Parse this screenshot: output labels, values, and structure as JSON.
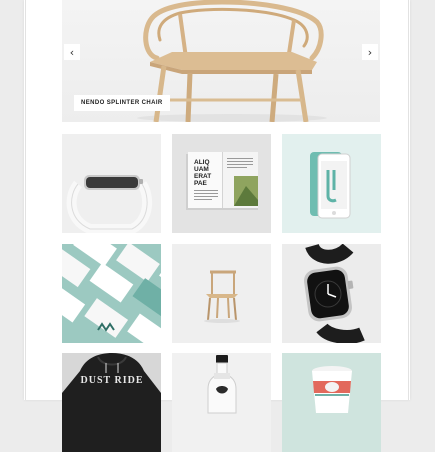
{
  "slider": {
    "caption": "NENDO SPLINTER CHAIR",
    "prev_icon": "chevron-left-icon",
    "next_icon": "chevron-right-icon",
    "prev_glyph": "‹",
    "next_glyph": "›"
  },
  "grid": {
    "magazine_headline_lines": [
      "ALIQ",
      "UAM",
      "ERAT",
      "PAE"
    ],
    "hoodie_print": "DUST RIDE"
  }
}
